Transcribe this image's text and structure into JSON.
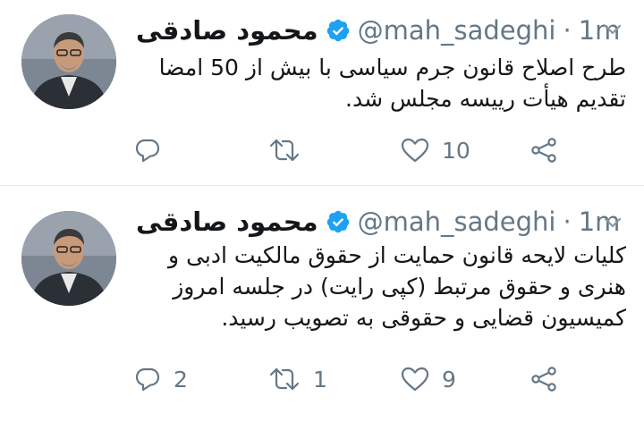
{
  "tweets": [
    {
      "author_name": "محمود صادقی",
      "handle": "@mah_sadeghi",
      "separator": "·",
      "time": "1m",
      "text_lines": [
        "طرح اصلاح قانون جرم سیاسی با بیش از 50 امضا",
        "تقدیم هیأت رییسه مجلس شد."
      ],
      "reply_count": "",
      "retweet_count": "",
      "like_count": "10"
    },
    {
      "author_name": "محمود صادقی",
      "handle": "@mah_sadeghi",
      "separator": "·",
      "time": "1m",
      "text_lines": [
        "کلیات لایحه قانون حمایت از حقوق مالکیت ادبی و",
        "هنری و حقوق مرتبط (کپی رایت) در جلسه امروز",
        "کمیسیون قضایی و حقوقی به تصویب رسید."
      ],
      "reply_count": "2",
      "retweet_count": "1",
      "like_count": "9"
    }
  ],
  "colors": {
    "text": "#14171a",
    "secondary": "#657786",
    "verified": "#1da1f2",
    "divider": "#e1e8ed"
  },
  "icons": [
    "avatar-photo",
    "verified-badge-icon",
    "chevron-down-icon",
    "reply-icon",
    "retweet-icon",
    "like-icon",
    "share-icon"
  ]
}
